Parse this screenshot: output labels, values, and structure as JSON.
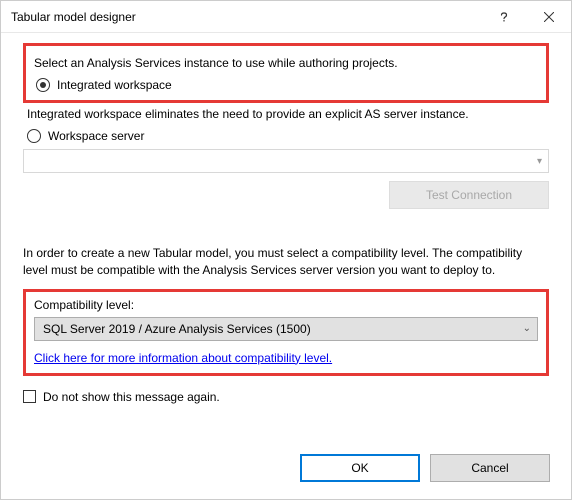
{
  "titlebar": {
    "title": "Tabular model designer"
  },
  "section1": {
    "instruction": "Select an Analysis Services instance to use while authoring projects.",
    "radio_integrated_label": "Integrated workspace",
    "integrated_desc": "Integrated workspace eliminates the need to provide an explicit AS server instance.",
    "radio_server_label": "Workspace server",
    "test_connection_label": "Test Connection"
  },
  "section2": {
    "compat_text": "In order to create a new Tabular model, you must select a compatibility level. The compatibility level must be compatible with the Analysis Services server version you want to deploy to.",
    "compat_label": "Compatibility level:",
    "dropdown_value": "SQL Server 2019 / Azure Analysis Services (1500)",
    "link_text": "Click here for more information about compatibility level."
  },
  "checkbox": {
    "label": "Do not show this message again."
  },
  "buttons": {
    "ok": "OK",
    "cancel": "Cancel"
  }
}
